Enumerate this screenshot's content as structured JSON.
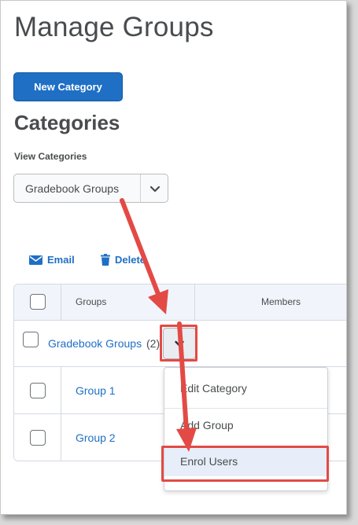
{
  "page": {
    "title": "Manage Groups"
  },
  "actions": {
    "new_category": "New Category"
  },
  "categories": {
    "heading": "Categories",
    "view_label": "View Categories",
    "selected": "Gradebook Groups"
  },
  "toolbar": {
    "email": "Email",
    "delete": "Delete"
  },
  "table": {
    "headers": {
      "groups": "Groups",
      "members": "Members"
    },
    "category_row": {
      "name": "Gradebook Groups",
      "count": "(2)"
    },
    "rows": [
      {
        "name": "Group 1"
      },
      {
        "name": "Group 2"
      }
    ]
  },
  "context_menu": {
    "items": [
      {
        "label": "Edit Category"
      },
      {
        "label": "Add Group"
      },
      {
        "label": "Enrol Users"
      }
    ]
  },
  "annotation_color": "#e34a45",
  "accent": "#1f6fc5"
}
